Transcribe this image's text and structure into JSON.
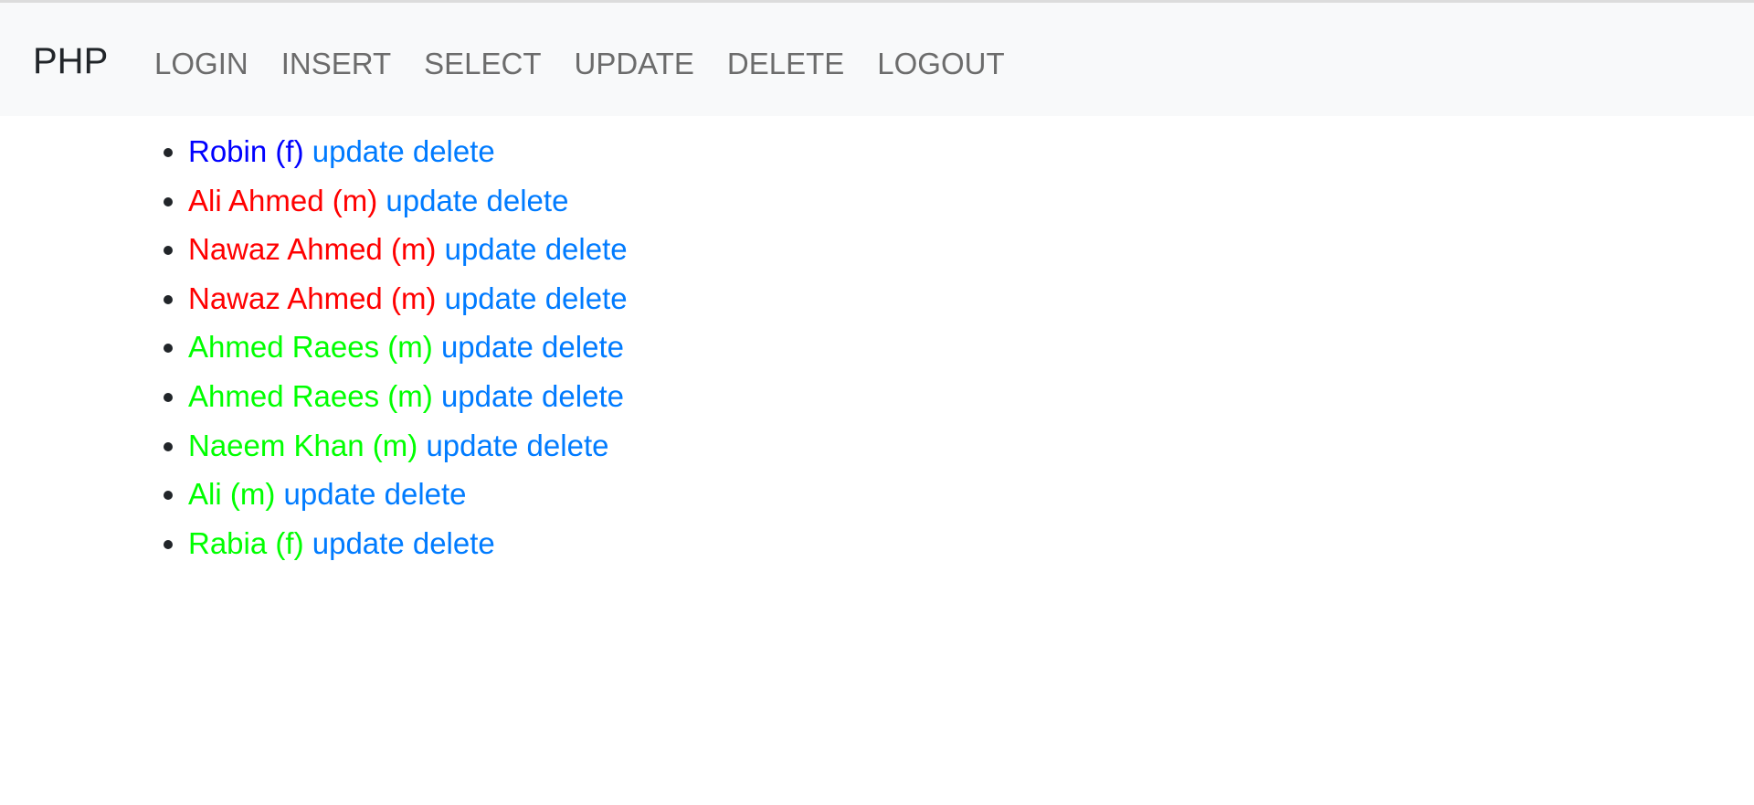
{
  "navbar": {
    "brand": "PHP",
    "items": [
      {
        "label": "LOGIN"
      },
      {
        "label": "INSERT"
      },
      {
        "label": "SELECT"
      },
      {
        "label": "UPDATE"
      },
      {
        "label": "DELETE"
      },
      {
        "label": "LOGOUT"
      }
    ]
  },
  "colors": {
    "navbar_bg": "#f8f9fa",
    "nav_link": "#6c6c6c",
    "link_blue": "#007bff",
    "person_blue": "#0000ff",
    "person_red": "#ff0000",
    "person_green": "#00ff00"
  },
  "people": [
    {
      "name": "Robin",
      "gender": "(f)",
      "color": "#0000ff",
      "update_label": "update",
      "delete_label": "delete"
    },
    {
      "name": "Ali Ahmed",
      "gender": "(m)",
      "color": "#ff0000",
      "update_label": "update",
      "delete_label": "delete"
    },
    {
      "name": "Nawaz Ahmed",
      "gender": "(m)",
      "color": "#ff0000",
      "update_label": "update",
      "delete_label": "delete"
    },
    {
      "name": "Nawaz Ahmed",
      "gender": "(m)",
      "color": "#ff0000",
      "update_label": "update",
      "delete_label": "delete"
    },
    {
      "name": "Ahmed Raees",
      "gender": "(m)",
      "color": "#00ff00",
      "update_label": "update",
      "delete_label": "delete"
    },
    {
      "name": "Ahmed Raees",
      "gender": "(m)",
      "color": "#00ff00",
      "update_label": "update",
      "delete_label": "delete"
    },
    {
      "name": "Naeem Khan",
      "gender": "(m)",
      "color": "#00ff00",
      "update_label": "update",
      "delete_label": "delete"
    },
    {
      "name": "Ali",
      "gender": "(m)",
      "color": "#00ff00",
      "update_label": "update",
      "delete_label": "delete"
    },
    {
      "name": "Rabia",
      "gender": "(f)",
      "color": "#00ff00",
      "update_label": "update",
      "delete_label": "delete"
    }
  ]
}
